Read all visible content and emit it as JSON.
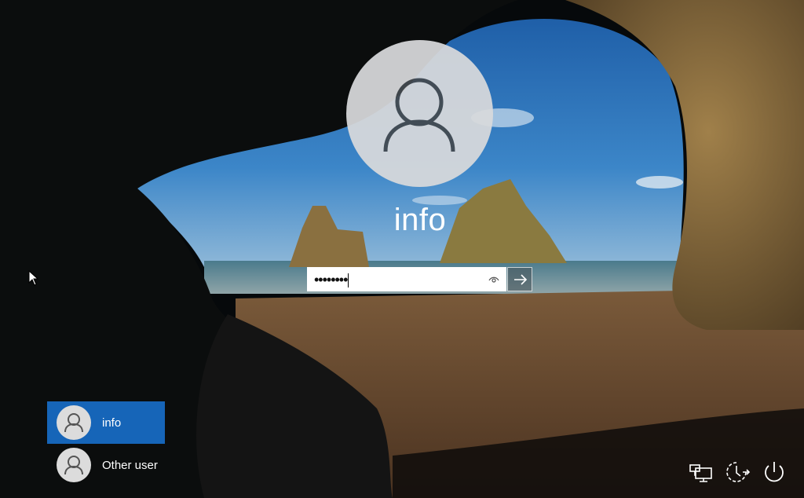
{
  "login": {
    "username": "info",
    "password_mask": "••••••••"
  },
  "user_list": [
    {
      "label": "info",
      "selected": true
    },
    {
      "label": "Other user",
      "selected": false
    }
  ],
  "icons": {
    "avatar": "user-icon",
    "reveal": "eye-icon",
    "submit": "arrow-right-icon",
    "network": "network-icon",
    "accessibility": "ease-of-access-icon",
    "power": "power-icon",
    "cursor": "mouse-pointer-icon"
  },
  "colors": {
    "selected_user": "#1665b8",
    "text": "#ffffff"
  }
}
